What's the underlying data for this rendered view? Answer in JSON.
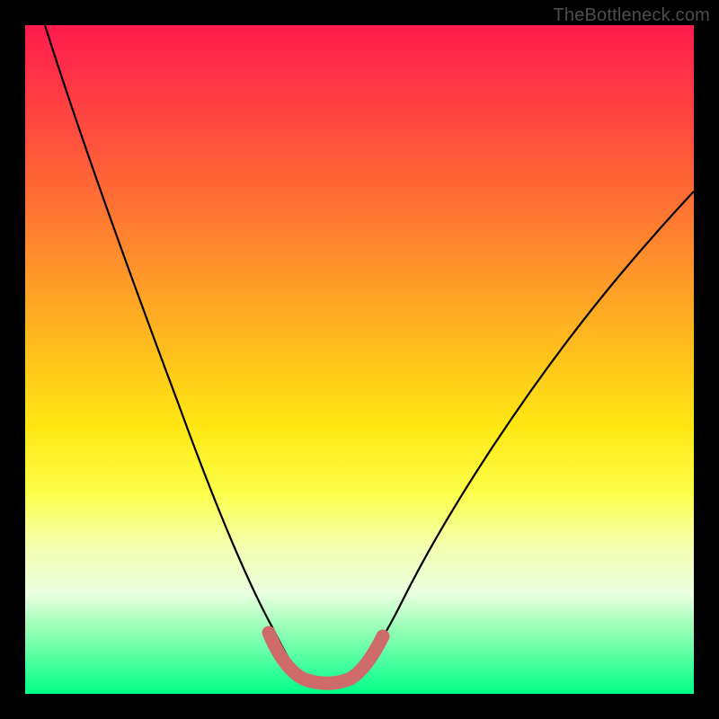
{
  "watermark": "TheBottleneck.com",
  "chart_data": {
    "type": "line",
    "title": "",
    "xlabel": "",
    "ylabel": "",
    "xlim": [
      0,
      100
    ],
    "ylim": [
      0,
      100
    ],
    "series": [
      {
        "name": "curve",
        "x": [
          3,
          10,
          15,
          20,
          25,
          30,
          33,
          35,
          37,
          39,
          41,
          43,
          45,
          47,
          49,
          53,
          58,
          65,
          75,
          85,
          95,
          100
        ],
        "y": [
          100,
          80,
          66,
          53,
          40,
          28,
          18,
          12,
          7,
          4,
          2.5,
          2,
          2,
          2.5,
          4,
          8,
          14,
          23,
          36,
          49,
          62,
          68
        ]
      },
      {
        "name": "highlight-band",
        "x": [
          37,
          39,
          41,
          43,
          45,
          47,
          49
        ],
        "y": [
          7,
          4,
          2.5,
          2,
          2,
          2.5,
          4
        ]
      }
    ],
    "colors": {
      "curve": "#000000",
      "highlight": "#cc6666"
    }
  }
}
